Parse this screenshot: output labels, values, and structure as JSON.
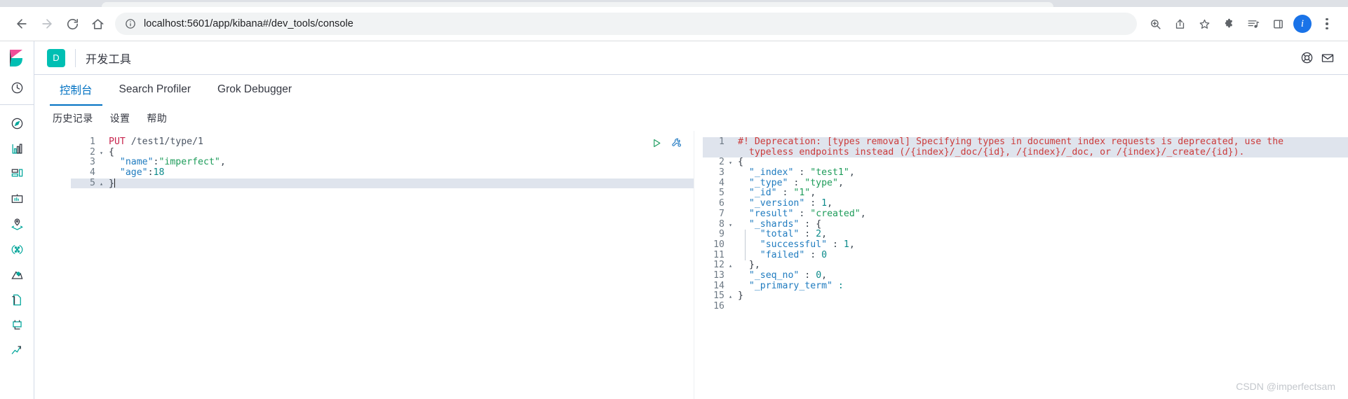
{
  "browser": {
    "url": "localhost:5601/app/kibana#/dev_tools/console",
    "back_label": "Back",
    "forward_label": "Forward",
    "reload_label": "Reload",
    "home_label": "Home",
    "site_info_label": "Site information",
    "actions": [
      {
        "name": "zoom-icon",
        "label": "Zoom"
      },
      {
        "name": "share-icon",
        "label": "Share this page"
      },
      {
        "name": "bookmark-star-icon",
        "label": "Bookmark this tab"
      },
      {
        "name": "extensions-puzzle-icon",
        "label": "Extensions"
      },
      {
        "name": "media-list-icon",
        "label": "Media list"
      },
      {
        "name": "side-panel-icon",
        "label": "Side panel"
      }
    ],
    "profile_initial": "i",
    "menu_label": "Customize and control"
  },
  "kibana": {
    "logo_label": "Elastic Kibana",
    "space_badge": "D",
    "app_title": "开发工具",
    "header_icons": [
      {
        "name": "help-lifebuoy-icon",
        "label": "Help"
      },
      {
        "name": "newsfeed-mail-icon",
        "label": "Newsfeed"
      }
    ],
    "nav_rail": [
      {
        "name": "sidebar-item-recently-viewed",
        "icon": "clock-icon",
        "label": "Recently viewed",
        "selected": false
      },
      {
        "name": "sidebar-item-discover",
        "icon": "compass-icon",
        "label": "Discover",
        "selected": false
      },
      {
        "name": "sidebar-item-visualize",
        "icon": "bar-chart-icon",
        "label": "Visualize",
        "selected": false
      },
      {
        "name": "sidebar-item-dashboard",
        "icon": "dashboard-grid-icon",
        "label": "Dashboard",
        "selected": false
      },
      {
        "name": "sidebar-item-canvas",
        "icon": "presentation-icon",
        "label": "Canvas",
        "selected": false
      },
      {
        "name": "sidebar-item-maps",
        "icon": "map-pin-layers-icon",
        "label": "Maps",
        "selected": false
      },
      {
        "name": "sidebar-item-machine-learning",
        "icon": "machine-learning-icon",
        "label": "Machine Learning",
        "selected": false
      },
      {
        "name": "sidebar-item-infrastructure",
        "icon": "infrastructure-icon",
        "label": "Infrastructure",
        "selected": false
      },
      {
        "name": "sidebar-item-logs",
        "icon": "logs-pages-icon",
        "label": "Logs",
        "selected": false
      },
      {
        "name": "sidebar-item-apm",
        "icon": "apm-trace-icon",
        "label": "APM",
        "selected": false
      },
      {
        "name": "sidebar-item-uptime",
        "icon": "uptime-arrow-icon",
        "label": "Uptime",
        "selected": false
      }
    ],
    "tabs": [
      {
        "label": "控制台",
        "active": true
      },
      {
        "label": "Search Profiler",
        "active": false
      },
      {
        "label": "Grok Debugger",
        "active": false
      }
    ],
    "console_menu": [
      {
        "label": "历史记录"
      },
      {
        "label": "设置"
      },
      {
        "label": "帮助"
      }
    ],
    "request_actions": [
      {
        "name": "send-request-play-icon",
        "label": "Click to send request"
      },
      {
        "name": "request-wrench-icon",
        "label": "Open documentation"
      }
    ],
    "watermark": "CSDN @imperfectsam"
  },
  "request_editor": {
    "lines": [
      {
        "n": "1",
        "fold": "",
        "highlight": false,
        "tokens": [
          {
            "t": "PUT",
            "c": "tk-method"
          },
          {
            "t": " /test1/type/1",
            "c": "tk-url"
          }
        ]
      },
      {
        "n": "2",
        "fold": "▾",
        "highlight": false,
        "tokens": [
          {
            "t": "{",
            "c": "tk-brace"
          }
        ]
      },
      {
        "n": "3",
        "fold": "",
        "highlight": false,
        "tokens": [
          {
            "t": "  ",
            "c": "tk-punct"
          },
          {
            "t": "\"name\"",
            "c": "tk-key"
          },
          {
            "t": ":",
            "c": "tk-punct"
          },
          {
            "t": "\"imperfect\"",
            "c": "tk-str"
          },
          {
            "t": ",",
            "c": "tk-punct"
          }
        ]
      },
      {
        "n": "4",
        "fold": "",
        "highlight": false,
        "tokens": [
          {
            "t": "  ",
            "c": "tk-punct"
          },
          {
            "t": "\"age\"",
            "c": "tk-key"
          },
          {
            "t": ":",
            "c": "tk-punct"
          },
          {
            "t": "18",
            "c": "tk-num"
          }
        ]
      },
      {
        "n": "5",
        "fold": "▴",
        "highlight": true,
        "caret": true,
        "tokens": [
          {
            "t": "}",
            "c": "tk-brace"
          }
        ]
      }
    ]
  },
  "response_editor": {
    "lines": [
      {
        "n": "1",
        "fold": "",
        "highlight": true,
        "tokens": [
          {
            "t": "#! Deprecation: [types removal] Specifying types in document index requests is deprecated, use the",
            "c": "tk-warn"
          }
        ]
      },
      {
        "n": "",
        "fold": "",
        "highlight": true,
        "tokens": [
          {
            "t": "  typeless endpoints instead (/{index}/_doc/{id}, /{index}/_doc, or /{index}/_create/{id}).",
            "c": "tk-warn"
          }
        ]
      },
      {
        "n": "2",
        "fold": "▾",
        "highlight": false,
        "tokens": [
          {
            "t": "{",
            "c": "tk-brace"
          }
        ]
      },
      {
        "n": "3",
        "fold": "",
        "highlight": false,
        "tokens": [
          {
            "t": "  ",
            "c": "tk-punct"
          },
          {
            "t": "\"_index\"",
            "c": "tk-key"
          },
          {
            "t": " : ",
            "c": "tk-punct"
          },
          {
            "t": "\"test1\"",
            "c": "tk-str"
          },
          {
            "t": ",",
            "c": "tk-punct"
          }
        ]
      },
      {
        "n": "4",
        "fold": "",
        "highlight": false,
        "tokens": [
          {
            "t": "  ",
            "c": "tk-punct"
          },
          {
            "t": "\"_type\"",
            "c": "tk-key"
          },
          {
            "t": " : ",
            "c": "tk-punct"
          },
          {
            "t": "\"type\"",
            "c": "tk-str"
          },
          {
            "t": ",",
            "c": "tk-punct"
          }
        ]
      },
      {
        "n": "5",
        "fold": "",
        "highlight": false,
        "tokens": [
          {
            "t": "  ",
            "c": "tk-punct"
          },
          {
            "t": "\"_id\"",
            "c": "tk-key"
          },
          {
            "t": " : ",
            "c": "tk-punct"
          },
          {
            "t": "\"1\"",
            "c": "tk-str"
          },
          {
            "t": ",",
            "c": "tk-punct"
          }
        ]
      },
      {
        "n": "6",
        "fold": "",
        "highlight": false,
        "tokens": [
          {
            "t": "  ",
            "c": "tk-punct"
          },
          {
            "t": "\"_version\"",
            "c": "tk-key"
          },
          {
            "t": " : ",
            "c": "tk-punct"
          },
          {
            "t": "1",
            "c": "tk-num"
          },
          {
            "t": ",",
            "c": "tk-punct"
          }
        ]
      },
      {
        "n": "7",
        "fold": "",
        "highlight": false,
        "tokens": [
          {
            "t": "  ",
            "c": "tk-punct"
          },
          {
            "t": "\"result\"",
            "c": "tk-key"
          },
          {
            "t": " : ",
            "c": "tk-punct"
          },
          {
            "t": "\"created\"",
            "c": "tk-str"
          },
          {
            "t": ",",
            "c": "tk-punct"
          }
        ]
      },
      {
        "n": "8",
        "fold": "▾",
        "highlight": false,
        "tokens": [
          {
            "t": "  ",
            "c": "tk-punct"
          },
          {
            "t": "\"_shards\"",
            "c": "tk-key"
          },
          {
            "t": " : ",
            "c": "tk-punct"
          },
          {
            "t": "{",
            "c": "tk-brace"
          }
        ]
      },
      {
        "n": "9",
        "fold": "",
        "highlight": false,
        "tokens": [
          {
            "t": "    ",
            "c": "tk-punct"
          },
          {
            "t": "\"total\"",
            "c": "tk-key"
          },
          {
            "t": " : ",
            "c": "tk-punct"
          },
          {
            "t": "2",
            "c": "tk-num"
          },
          {
            "t": ",",
            "c": "tk-punct"
          }
        ]
      },
      {
        "n": "10",
        "fold": "",
        "highlight": false,
        "tokens": [
          {
            "t": "    ",
            "c": "tk-punct"
          },
          {
            "t": "\"successful\"",
            "c": "tk-key"
          },
          {
            "t": " : ",
            "c": "tk-punct"
          },
          {
            "t": "1",
            "c": "tk-num"
          },
          {
            "t": ",",
            "c": "tk-punct"
          }
        ]
      },
      {
        "n": "11",
        "fold": "",
        "highlight": false,
        "tokens": [
          {
            "t": "    ",
            "c": "tk-punct"
          },
          {
            "t": "\"failed\"",
            "c": "tk-key"
          },
          {
            "t": " : ",
            "c": "tk-punct"
          },
          {
            "t": "0",
            "c": "tk-num"
          }
        ]
      },
      {
        "n": "12",
        "fold": "▴",
        "highlight": false,
        "tokens": [
          {
            "t": "  ",
            "c": "tk-punct"
          },
          {
            "t": "}",
            "c": "tk-brace"
          },
          {
            "t": ",",
            "c": "tk-punct"
          }
        ]
      },
      {
        "n": "13",
        "fold": "",
        "highlight": false,
        "tokens": [
          {
            "t": "  ",
            "c": "tk-punct"
          },
          {
            "t": "\"_seq_no\"",
            "c": "tk-key"
          },
          {
            "t": " : ",
            "c": "tk-punct"
          },
          {
            "t": "0",
            "c": "tk-num"
          },
          {
            "t": ",",
            "c": "tk-punct"
          }
        ]
      },
      {
        "n": "14",
        "fold": "",
        "highlight": false,
        "tokens": [
          {
            "t": "  ",
            "c": "tk-punct"
          },
          {
            "t": "\"_primary_term\"",
            "c": "tk-key"
          },
          {
            "t": " : ",
            "c": "tk-num"
          }
        ]
      },
      {
        "n": "15",
        "fold": "▴",
        "highlight": false,
        "tokens": [
          {
            "t": "}",
            "c": "tk-brace"
          }
        ]
      },
      {
        "n": "16",
        "fold": "",
        "highlight": false,
        "tokens": []
      }
    ]
  }
}
